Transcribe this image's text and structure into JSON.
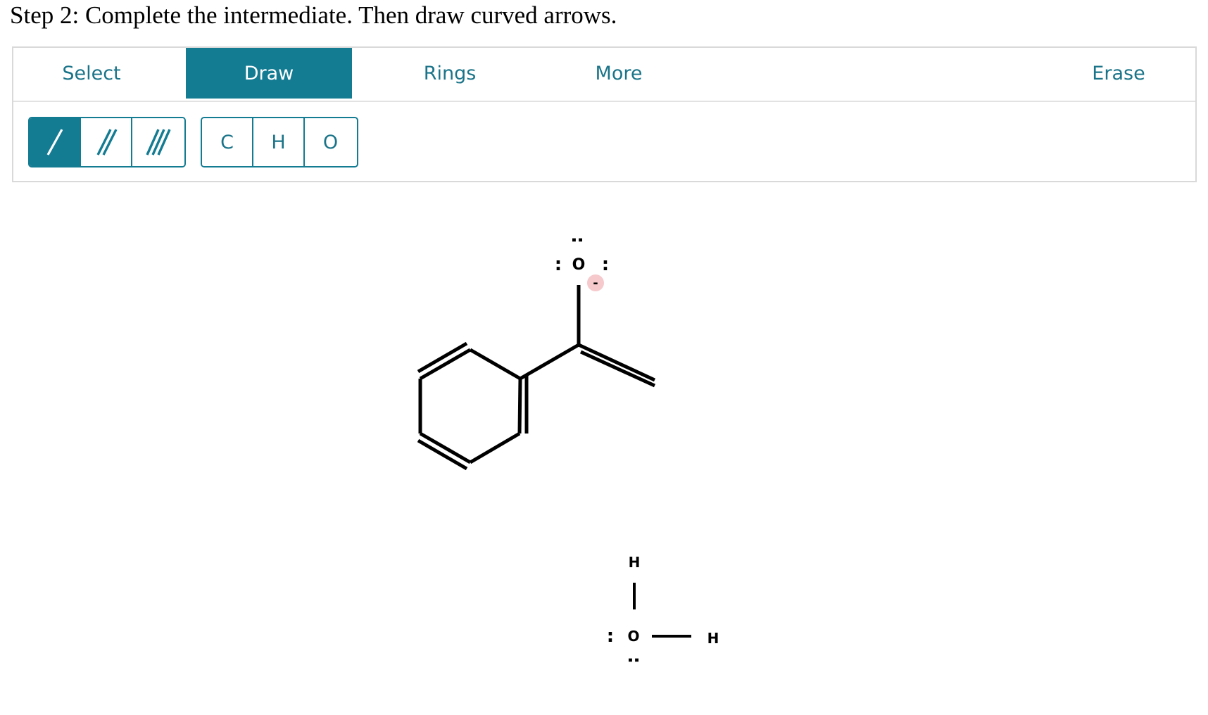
{
  "instruction": "Step 2: Complete the intermediate. Then draw curved arrows.",
  "tabs": {
    "select": "Select",
    "draw": "Draw",
    "rings": "Rings",
    "more": "More",
    "erase": "Erase"
  },
  "active_tab": "Draw",
  "bond_tools": [
    "single-bond",
    "double-bond",
    "triple-bond"
  ],
  "active_bond_tool": "single-bond",
  "atom_tools": {
    "carbon": "C",
    "hydrogen": "H",
    "oxygen": "O"
  },
  "molecule_1": {
    "oxygen_label": "O",
    "lone_pair_dots": ":",
    "charge": "-"
  },
  "molecule_2": {
    "oxygen_label": "O",
    "hydrogen_top": "H",
    "hydrogen_right": "H",
    "lone_pair_dots": ":"
  },
  "colors": {
    "accent": "#137b92",
    "charge_badge": "#f6c9cc"
  }
}
